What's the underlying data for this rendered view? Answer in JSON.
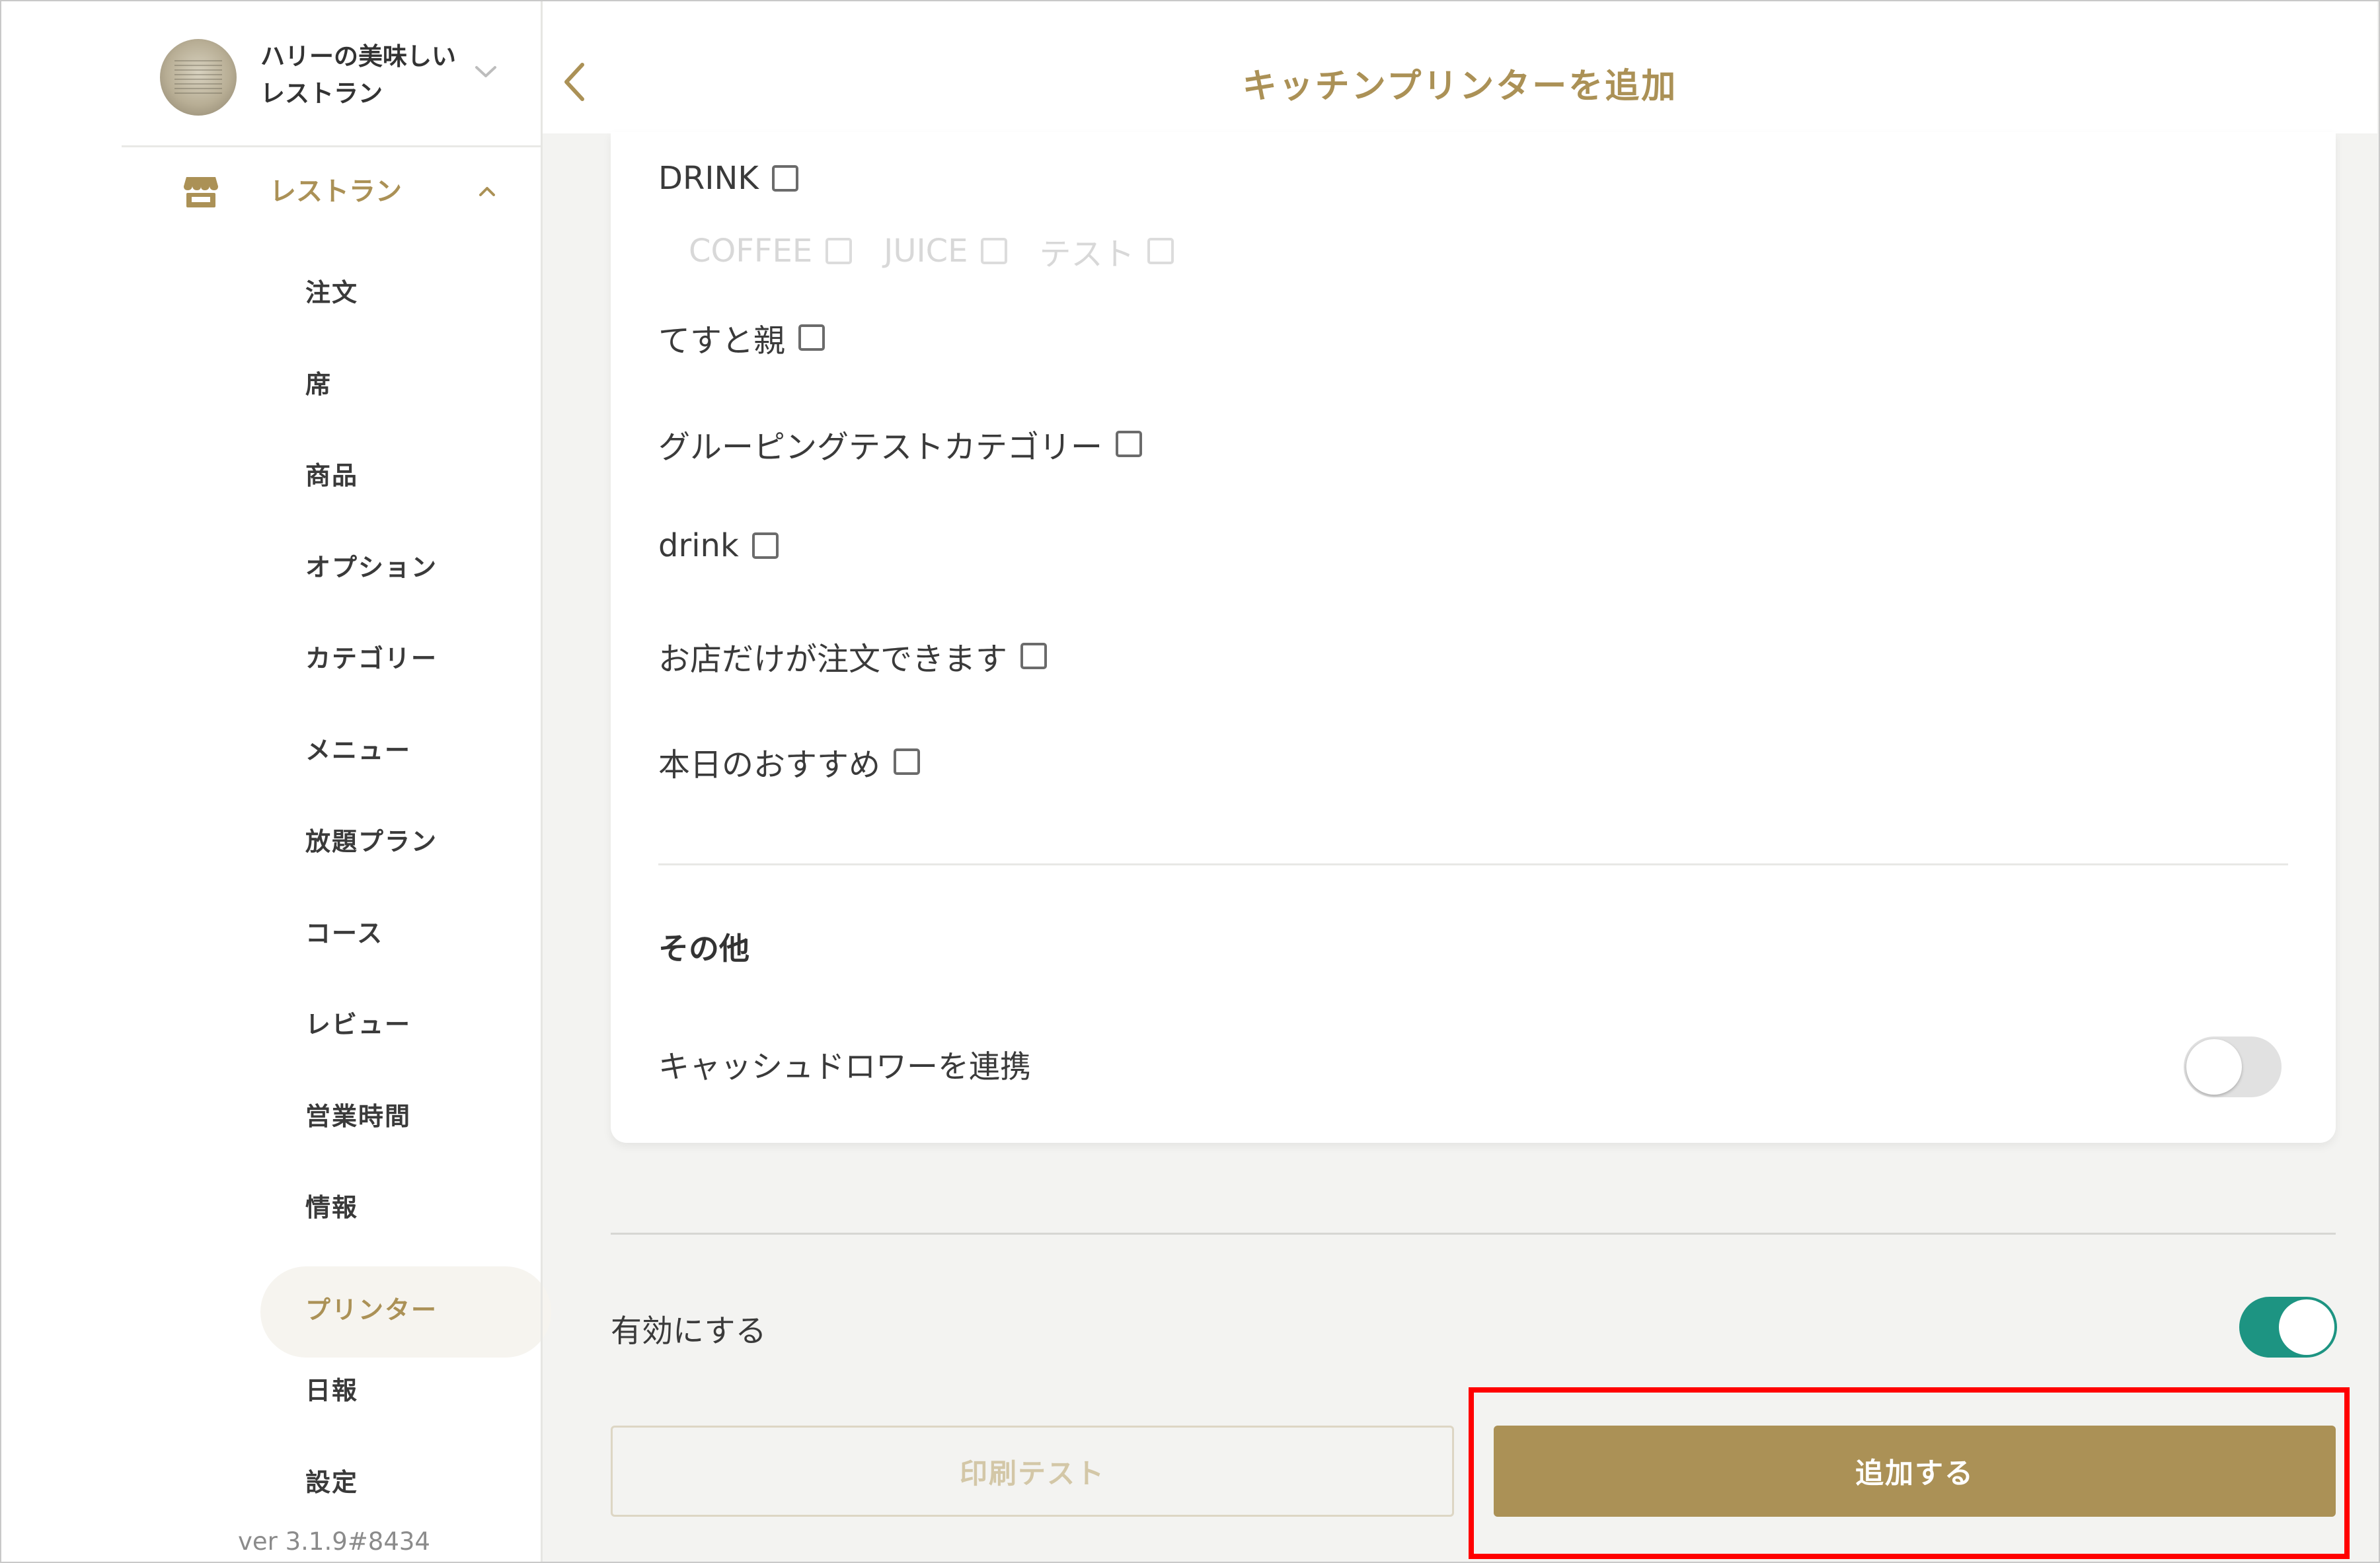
{
  "shop": {
    "name": "ハリーの美味しいレストラン"
  },
  "section": {
    "label": "レストラン"
  },
  "nav": {
    "items": [
      {
        "label": "注文"
      },
      {
        "label": "席"
      },
      {
        "label": "商品"
      },
      {
        "label": "オプション"
      },
      {
        "label": "カテゴリー"
      },
      {
        "label": "メニュー"
      },
      {
        "label": "放題プラン"
      },
      {
        "label": "コース"
      },
      {
        "label": "レビュー"
      },
      {
        "label": "営業時間"
      },
      {
        "label": "情報"
      },
      {
        "label": "プリンター",
        "active": true
      },
      {
        "label": "日報"
      },
      {
        "label": "設定"
      }
    ]
  },
  "version": "ver 3.1.9#8434",
  "header": {
    "title": "キッチンプリンターを追加"
  },
  "categories": {
    "drink_upper": "DRINK",
    "drink_children": [
      "COFFEE",
      "JUICE",
      "テスト"
    ],
    "test_parent": "てすと親",
    "grouping": "グルーピングテストカテゴリー",
    "drink_lower": "drink",
    "store_only": "お店だけが注文できます",
    "recommend": "本日のおすすめ"
  },
  "other": {
    "title": "その他",
    "cash_drawer": {
      "label": "キャッシュドロワーを連携",
      "enabled": false
    }
  },
  "enable": {
    "label": "有効にする",
    "enabled": true
  },
  "buttons": {
    "print_test": "印刷テスト",
    "add": "追加する"
  },
  "colors": {
    "accent": "#ab9156",
    "toggle_on": "#1d9482",
    "highlight": "#ff0000"
  }
}
